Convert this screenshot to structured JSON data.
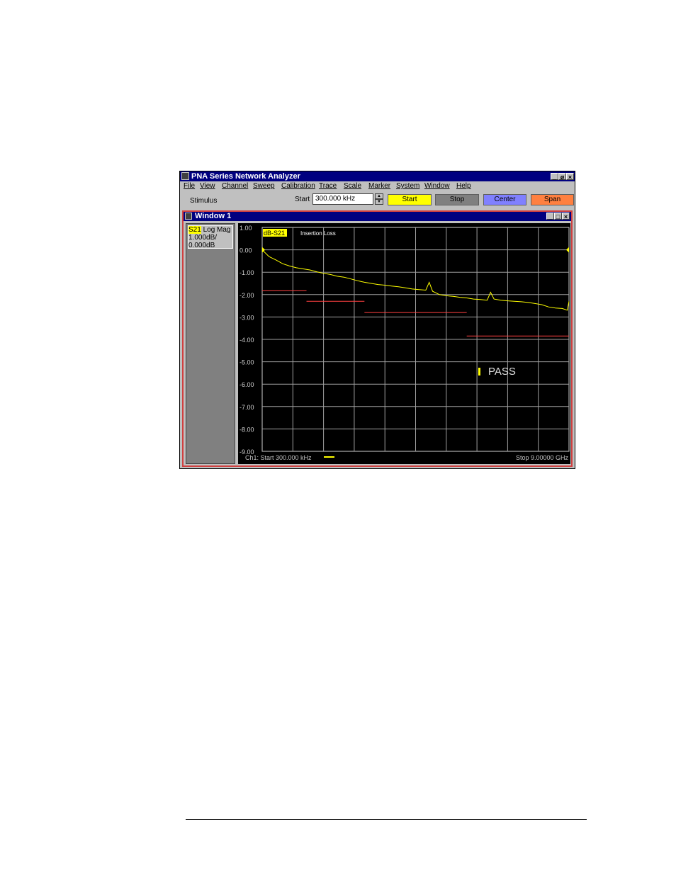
{
  "app": {
    "title": "PNA Series Network Analyzer",
    "window_buttons": [
      "_",
      "ø",
      "×"
    ]
  },
  "menu": [
    "File",
    "View",
    "Channel",
    "Sweep",
    "Calibration",
    "Trace",
    "Scale",
    "Marker",
    "System",
    "Window",
    "Help"
  ],
  "toolbar": {
    "stimulus_label": "Stimulus",
    "start_label": "Start",
    "start_value": "300.000 kHz",
    "buttons": [
      {
        "label": "Start",
        "color": "#ffff00"
      },
      {
        "label": "Stop",
        "color": "#808080"
      },
      {
        "label": "Center",
        "color": "#8080ff"
      },
      {
        "label": "Span",
        "color": "#ff8040"
      }
    ]
  },
  "child_window": {
    "title": "Window 1",
    "trace_info": {
      "param": "S21",
      "format": "Log Mag",
      "scale": "1.000dB/",
      "ref": "0.000dB"
    }
  },
  "chart_data": {
    "type": "line",
    "trace_tag": "dB-S21",
    "title": "Insertion Loss",
    "status": "PASS",
    "start_label": "Ch1: Start  300.000 kHz",
    "stop_label": "Stop  9.00000 GHz",
    "y_ticks": [
      "1.00",
      "0.00",
      "-1.00",
      "-2.00",
      "-3.00",
      "-4.00",
      "-5.00",
      "-6.00",
      "-7.00",
      "-8.00",
      "-9.00"
    ],
    "ylim": [
      -9,
      1
    ],
    "xlim": [
      0.0003,
      9.0
    ],
    "x_unit": "GHz",
    "trace_color": "#ffff00",
    "limit_color": "#ff4040",
    "series": [
      {
        "x": [
          0.0003,
          0.2,
          0.4,
          0.6,
          0.8,
          1.0,
          1.2,
          1.4,
          1.6,
          1.8,
          2.0,
          2.2,
          2.4,
          2.6,
          2.8,
          3.0,
          3.2,
          3.4,
          3.6,
          3.8,
          4.0,
          4.2,
          4.4,
          4.6,
          4.8,
          4.9,
          5.0,
          5.2,
          5.4,
          5.6,
          5.8,
          6.0,
          6.2,
          6.4,
          6.6,
          6.7,
          6.8,
          7.0,
          7.2,
          7.4,
          7.6,
          7.8,
          8.0,
          8.2,
          8.4,
          8.6,
          8.8,
          8.95,
          9.0
        ],
        "y": [
          0.0,
          -0.3,
          -0.45,
          -0.62,
          -0.72,
          -0.8,
          -0.85,
          -0.9,
          -0.98,
          -1.05,
          -1.1,
          -1.18,
          -1.22,
          -1.3,
          -1.38,
          -1.45,
          -1.5,
          -1.55,
          -1.58,
          -1.62,
          -1.65,
          -1.7,
          -1.75,
          -1.78,
          -1.8,
          -1.45,
          -1.85,
          -2.0,
          -2.05,
          -2.08,
          -2.12,
          -2.15,
          -2.2,
          -2.22,
          -2.25,
          -1.9,
          -2.2,
          -2.25,
          -2.28,
          -2.3,
          -2.32,
          -2.35,
          -2.4,
          -2.45,
          -2.55,
          -2.6,
          -2.62,
          -2.7,
          -2.3
        ]
      }
    ],
    "limit_lines": [
      {
        "x": [
          0.0003,
          1.3
        ],
        "y": [
          -1.83,
          -1.83
        ]
      },
      {
        "x": [
          1.3,
          3.0
        ],
        "y": [
          -2.3,
          -2.3
        ]
      },
      {
        "x": [
          3.0,
          6.0
        ],
        "y": [
          -2.8,
          -2.8
        ]
      },
      {
        "x": [
          6.0,
          9.0
        ],
        "y": [
          -3.85,
          -3.85
        ]
      }
    ],
    "ref_value": 0.0,
    "grid": true
  }
}
